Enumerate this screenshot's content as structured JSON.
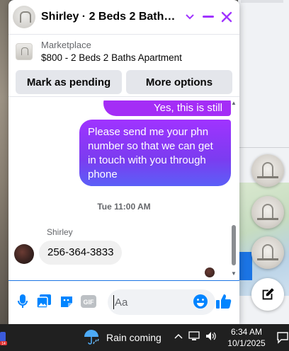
{
  "chat": {
    "title": "Shirley · 2 Beds 2 Baths Ap...",
    "listing": {
      "category": "Marketplace",
      "name": "$800 - 2 Beds 2 Baths Apartment"
    },
    "actions": {
      "mark_pending": "Mark as pending",
      "more_options": "More options"
    },
    "messages": {
      "outgoing_1": "Yes, this is still available",
      "outgoing_2": "Please send me your phn number so that we can get in touch with you through phone",
      "timestamp": "Tue 11:00 AM",
      "sender_name": "Shirley",
      "incoming_1": "256-364-3833"
    },
    "composer": {
      "placeholder": "Aa"
    }
  },
  "taskbar": {
    "weather": "Rain coming",
    "time": "6:34 AM",
    "date": "10/1/2025",
    "left_badge": "14"
  },
  "colors": {
    "accent": "#a033ff",
    "messenger_blue": "#0084ff",
    "taskbar": "#202020"
  },
  "icons": [
    "chevron-down-icon",
    "minimize-icon",
    "close-icon",
    "microphone-icon",
    "photo-icon",
    "sticker-icon",
    "gif-icon",
    "emoji-icon",
    "thumbs-up-icon",
    "compose-icon",
    "weather-icon",
    "chevron-up-icon",
    "network-icon",
    "volume-icon",
    "notification-icon"
  ]
}
